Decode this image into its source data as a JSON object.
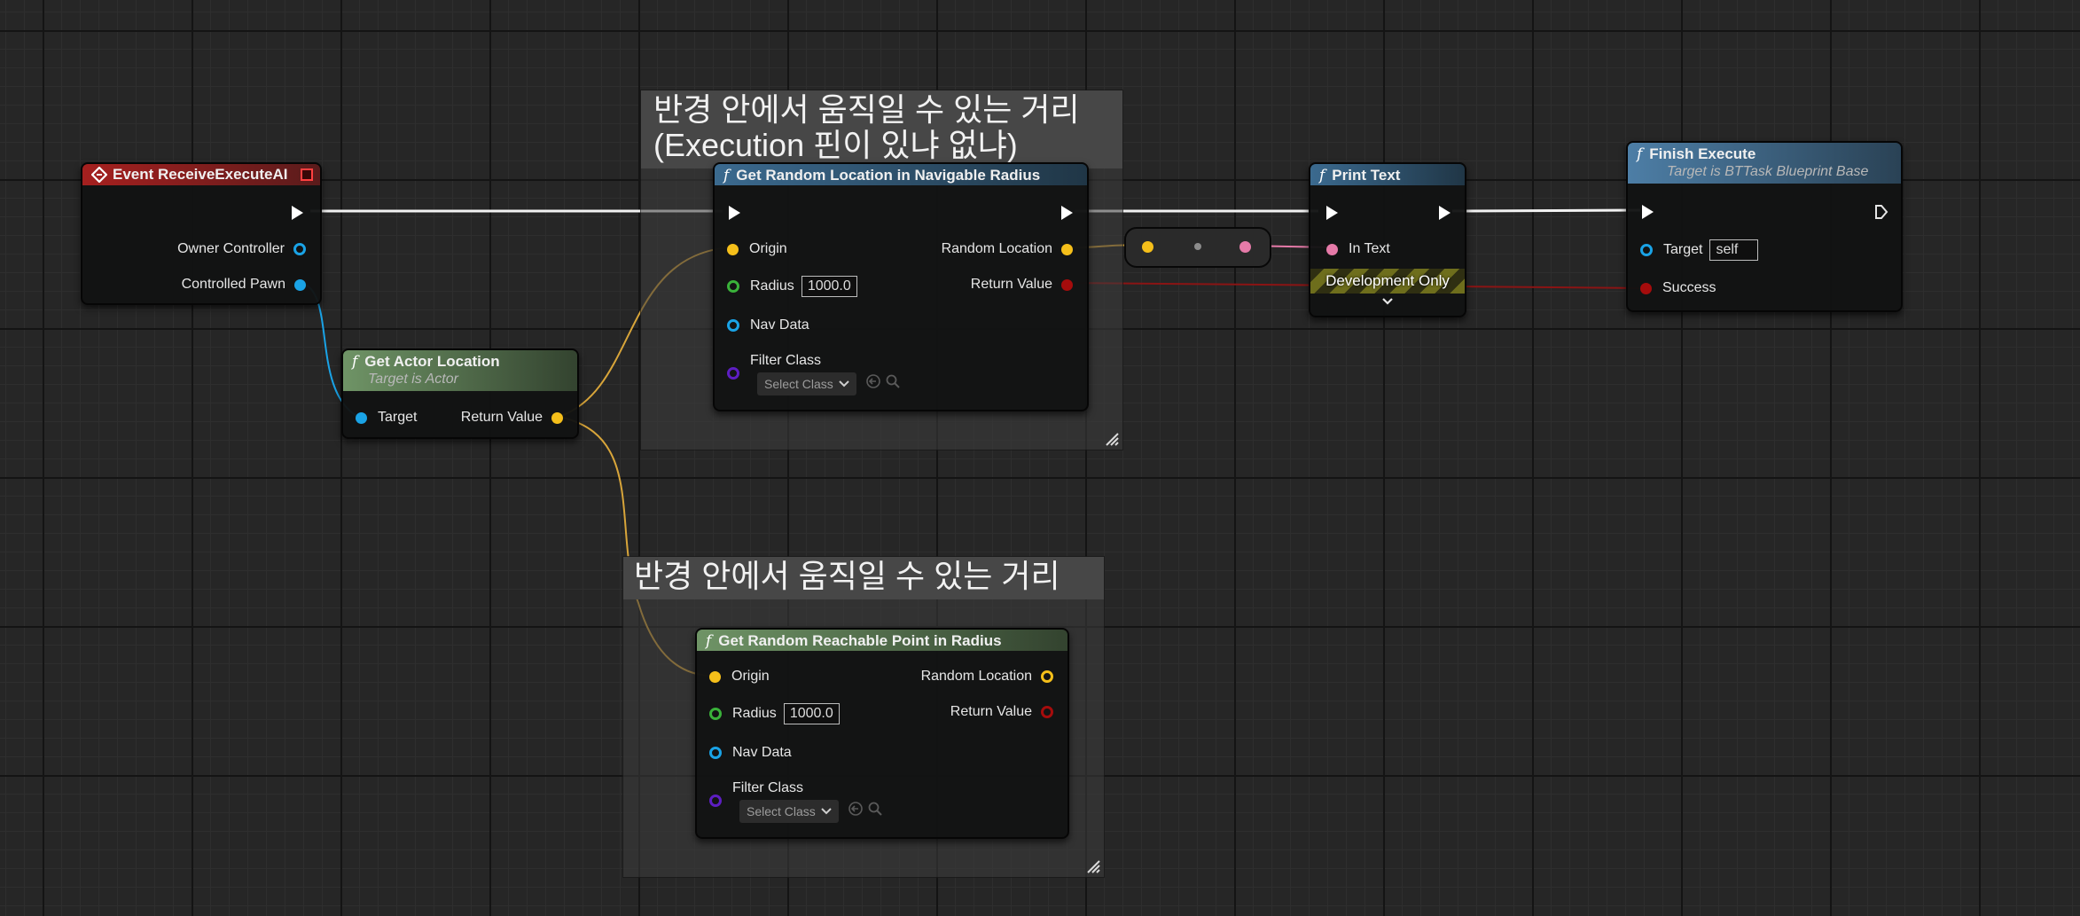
{
  "comments": {
    "top": {
      "title": "반경 안에서 움직일 수 있는 거리\n(Execution 핀이 있냐 없냐)"
    },
    "bottom": {
      "title": "반경 안에서 움직일 수 있는 거리"
    }
  },
  "nodes": {
    "event": {
      "title": "Event ReceiveExecuteAI",
      "owner_controller": "Owner Controller",
      "controlled_pawn": "Controlled Pawn"
    },
    "get_actor_location": {
      "title": "Get Actor Location",
      "subtitle": "Target is Actor",
      "target": "Target",
      "return_value": "Return Value"
    },
    "nav_radius": {
      "title": "Get Random Location in Navigable Radius",
      "origin": "Origin",
      "radius": "Radius",
      "radius_value": "1000.0",
      "nav_data": "Nav Data",
      "filter_class": "Filter Class",
      "select_class": "Select Class",
      "random_location": "Random Location",
      "return_value": "Return Value"
    },
    "reachable": {
      "title": "Get Random Reachable Point in Radius",
      "origin": "Origin",
      "radius": "Radius",
      "radius_value": "1000.0",
      "nav_data": "Nav Data",
      "filter_class": "Filter Class",
      "select_class": "Select Class",
      "random_location": "Random Location",
      "return_value": "Return Value"
    },
    "print_text": {
      "title": "Print Text",
      "in_text": "In Text",
      "dev_only": "Development Only"
    },
    "finish_execute": {
      "title": "Finish Execute",
      "subtitle": "Target is BTTask Blueprint Base",
      "target": "Target",
      "target_value": "self",
      "success": "Success"
    }
  },
  "icons": {
    "function": "function-icon",
    "event": "event-diamond-icon",
    "chevron": "chevron-down-icon",
    "search": "magnifier-icon",
    "reset": "reset-arrow-icon"
  },
  "colors": {
    "exec": "#ffffff",
    "object": "#1aa3e6",
    "vector": "#f5bf1a",
    "float": "#3ab23a",
    "bool": "#a50c0c",
    "text": "#e57aa8",
    "class": "#5d1ec2",
    "vector_wire": "#d8a53a",
    "bool_wire": "#8a1414"
  }
}
